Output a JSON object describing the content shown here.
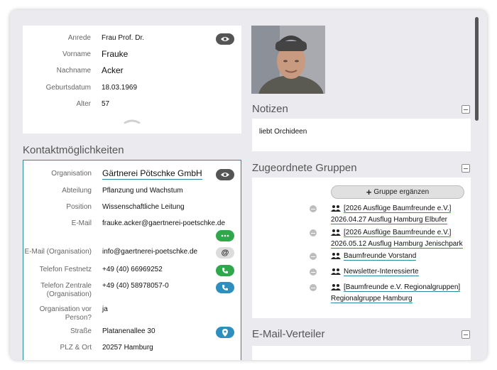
{
  "person": {
    "fields": [
      {
        "label": "Anrede",
        "value": "Frau Prof. Dr."
      },
      {
        "label": "Vorname",
        "value": "Frauke"
      },
      {
        "label": "Nachname",
        "value": "Acker"
      },
      {
        "label": "Geburtsdatum",
        "value": "18.03.1969"
      },
      {
        "label": "Alter",
        "value": "57"
      }
    ]
  },
  "contact": {
    "title": "Kontaktmöglichkeiten",
    "organisation_label": "Organisation",
    "organisation_value": "Gärtnerei Pötschke GmbH",
    "abteilung_label": "Abteilung",
    "abteilung_value": "Pflanzung und Wachstum",
    "position_label": "Position",
    "position_value": "Wissenschaftliche Leitung",
    "email_label": "E-Mail",
    "email_value": "frauke.acker@gaertnerei-poetschke.de",
    "email_org_label": "E-Mail (Organisation)",
    "email_org_value": "info@gaertnerei-poetschke.de",
    "tel_label": "Telefon Festnetz",
    "tel_value": "+49 (40) 66969252",
    "tel_org_label_1": "Telefon Zentrale",
    "tel_org_label_2": "(Organisation)",
    "tel_org_value": "+49 (40) 58978057-0",
    "org_person_label_1": "Organisation vor",
    "org_person_label_2": "Person?",
    "org_person_value": "ja",
    "street_label": "Straße",
    "street_value": "Platanenallee 30",
    "plz_label": "PLZ & Ort",
    "plz_value": "20257 Hamburg"
  },
  "notes": {
    "title": "Notizen",
    "text": "liebt Orchideen"
  },
  "groups": {
    "title": "Zugeordnete Gruppen",
    "add_button": "Gruppe ergänzen",
    "items": [
      {
        "line1": "[2026 Ausflüge Baumfreunde e.V.]",
        "line2": "2026.04.27 Ausflug Hamburg Elbufer"
      },
      {
        "line1": "[2026 Ausflüge Baumfreunde e.V.]",
        "line2": "2026.05.12 Ausflug Hamburg Jenischpark"
      },
      {
        "line1": "Baumfreunde Vorstand",
        "line2": ""
      },
      {
        "line1": "Newsletter-Interessierte",
        "line2": ""
      },
      {
        "line1": "[Baumfreunde e.V. Regionalgruppen]",
        "line2": "Regionalgruppe Hamburg"
      }
    ]
  },
  "mailing": {
    "title": "E-Mail-Verteiler"
  },
  "icons": {
    "eye": "eye-icon",
    "more": "more-icon",
    "at": "at-icon",
    "phone": "phone-icon",
    "location": "location-pin-icon",
    "people": "people-icon",
    "collapse": "collapse-icon",
    "plus": "plus-icon"
  },
  "colors": {
    "accent": "#2b8a9a",
    "green": "#2ea84a",
    "blue": "#2e8fbf",
    "dark_pill": "#555555",
    "light_pill": "#dcdcdc"
  }
}
